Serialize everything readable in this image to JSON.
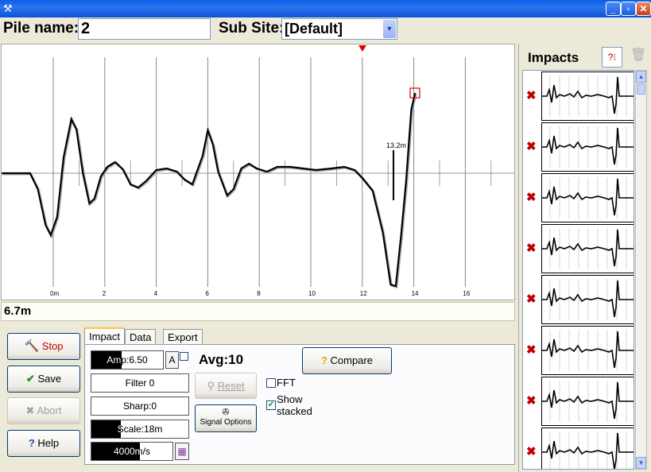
{
  "header": {
    "pile_label": "Pile name:",
    "pile_value": "2",
    "site_label": "Sub Site:",
    "site_value": "[Default]"
  },
  "chart": {
    "tick_labels": [
      "0m",
      "2",
      "4",
      "6",
      "8",
      "10",
      "12",
      "14",
      "16"
    ],
    "annotation": "13.2m",
    "marker_depth_m": 12,
    "cursor_depth_m": 14
  },
  "readout": "6.7m",
  "buttons": {
    "stop": "Stop",
    "save": "Save",
    "abort": "Abort",
    "help": "Help",
    "compare": "Compare",
    "reset": "Reset",
    "signal_options": "Signal Options",
    "amp_auto": "A"
  },
  "tabs": [
    "Impact",
    "Data",
    "Export"
  ],
  "controls": {
    "amp": "Amp:6.50",
    "amp_level": 0.42,
    "filter": "Filter 0",
    "filter_level": 0,
    "sharp": "Sharp:0",
    "sharp_level": 0,
    "scale": "Scale:18m",
    "scale_level": 0.3,
    "speed": "4000m/s",
    "speed_level": 0.6,
    "avg": "Avg:10",
    "fft_label": "FFT",
    "fft_checked": false,
    "stacked_label_1": "Show",
    "stacked_label_2": "stacked",
    "stacked_checked": true
  },
  "impacts": {
    "title": "Impacts",
    "count": 8
  },
  "colors": {
    "titlebar": "#0a5ee6",
    "delete_x": "#c00000",
    "marker": "#e00000"
  },
  "icons": [
    "stop-hammer-icon",
    "save-check-icon",
    "abort-x-icon",
    "help-question-icon",
    "compare-question-icon",
    "reset-icon",
    "signal-options-icon",
    "grid-icon",
    "impact-select-icon",
    "trash-icon",
    "delete-x-icon"
  ]
}
